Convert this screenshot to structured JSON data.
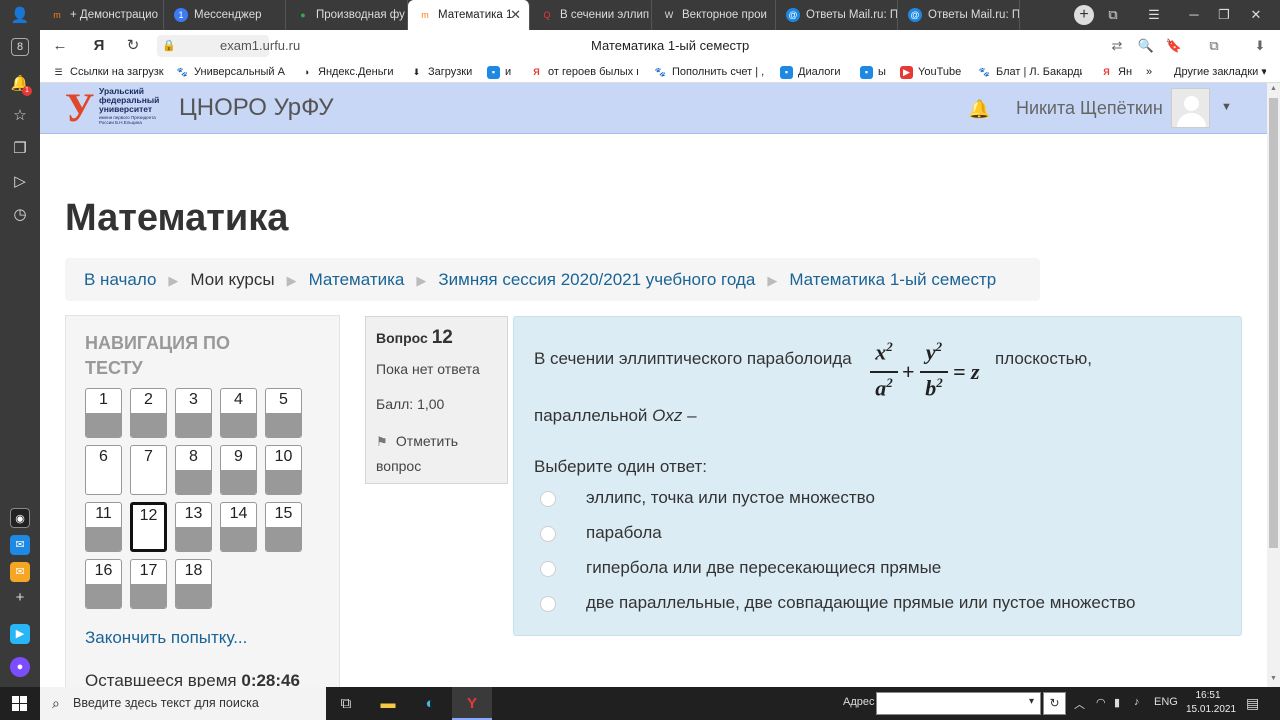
{
  "browser": {
    "tabs": [
      {
        "label": "+ Демонстрацио",
        "icon": "moodle-icon",
        "icon_color": "#f98012",
        "icon_char": "m"
      },
      {
        "label": "Мессенджер",
        "icon": "messenger-icon",
        "icon_color": "#3d7bf5",
        "icon_char": "1"
      },
      {
        "label": "Производная фу",
        "icon": "google-icon",
        "icon_color": "#34a853",
        "icon_char": "●"
      },
      {
        "label": "Математика 1",
        "icon": "moodle-icon",
        "icon_color": "#f98012",
        "icon_char": "m",
        "active": true
      },
      {
        "label": "В сечении эллип",
        "icon": "yandex-q-icon",
        "icon_color": "#e53935",
        "icon_char": "Q"
      },
      {
        "label": "Векторное прои",
        "icon": "wiki-icon",
        "icon_color": "#555555",
        "icon_char": "W"
      },
      {
        "label": "Ответы Mail.ru: П",
        "icon": "mailru-icon",
        "icon_color": "#1e88e5",
        "icon_char": "@"
      },
      {
        "label": "Ответы Mail.ru: П",
        "icon": "mailru-icon",
        "icon_color": "#1e88e5",
        "icon_char": "@"
      }
    ],
    "url": "exam1.urfu.ru",
    "page_title": "Математика 1-ый семестр",
    "bookmarks": [
      {
        "label": "Ссылки на загрузк",
        "icon": "list-icon"
      },
      {
        "label": "Универсальный А",
        "icon": "pawprint-icon"
      },
      {
        "label": "Яндекс.Деньги",
        "icon": "money-icon"
      },
      {
        "label": "Загрузки",
        "icon": "download-icon"
      },
      {
        "label": "и",
        "icon": "chat-icon"
      },
      {
        "label": "от героев былых в",
        "icon": "yandex-icon"
      },
      {
        "label": "Пополнить счет | ,",
        "icon": "pawprint-icon"
      },
      {
        "label": "Диалоги",
        "icon": "chat-icon"
      },
      {
        "label": "ы",
        "icon": "chat-icon"
      },
      {
        "label": "YouTube",
        "icon": "youtube-icon"
      },
      {
        "label": "Блат | Л. Бакарди",
        "icon": "pawprint-icon"
      },
      {
        "label": "Ян",
        "icon": "yandex-icon"
      }
    ],
    "other_bookmarks": "Другие закладки"
  },
  "site": {
    "logo": {
      "text": "Уральский федеральный университет",
      "subtext": "имени первого Президента России Б.Н.Ельцина"
    },
    "name": "ЦНОРО УрФУ",
    "user_name": "Никита Щепёткин"
  },
  "course_title": "Математика",
  "breadcrumb": [
    "В начало",
    "Мои курсы",
    "Математика",
    "Зимняя сессия 2020/2021 учебного года",
    "Математика 1-ый семестр"
  ],
  "quiz_nav": {
    "title": "НАВИГАЦИЯ ПО ТЕСТУ",
    "questions": [
      "1",
      "2",
      "3",
      "4",
      "5",
      "6",
      "7",
      "8",
      "9",
      "10",
      "11",
      "12",
      "13",
      "14",
      "15",
      "16",
      "17",
      "18"
    ],
    "finish_link": "Закончить попытку...",
    "time_label": "Оставшееся время",
    "time_value": "0:28:46"
  },
  "question_info": {
    "label": "Вопрос",
    "number": "12",
    "state": "Пока нет ответа",
    "grade": "Балл: 1,00",
    "flag": "Отметить вопрос"
  },
  "question": {
    "text_before": "В сечении эллиптического параболоида",
    "formula": {
      "num1": "x",
      "den1": "a",
      "num2": "y",
      "den2": "b",
      "exp": "2",
      "plus": "+",
      "eq": "= z"
    },
    "text_after": "плоскостью,",
    "text_line2_a": "параллельной",
    "plane": "Oxz",
    "text_line2_b": "–",
    "prompt": "Выберите один ответ:",
    "answers": [
      "эллипс, точка или пустое множество",
      "парабола",
      "гипербола или две пересекающиеся прямые",
      "две параллельные, две совпадающие прямые или пустое множество"
    ]
  },
  "taskbar": {
    "search_placeholder": "Введите здесь текст для поиска",
    "address_label": "Адрес",
    "lang": "ENG",
    "time": "16:51",
    "date": "15.01.2021"
  },
  "colors": {
    "header_bg": "#c8d7f5",
    "link": "#1a6496",
    "question_bg": "#dcecf4"
  }
}
